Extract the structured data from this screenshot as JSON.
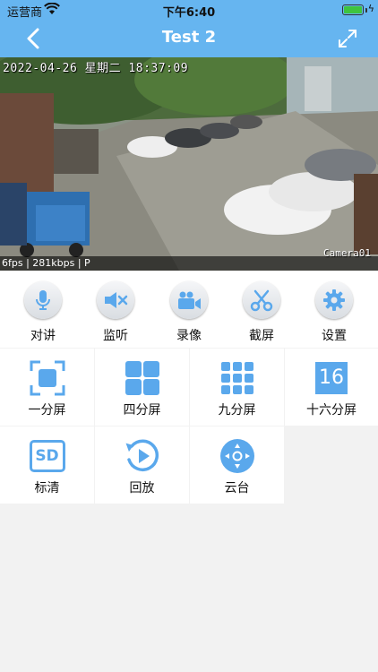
{
  "status_bar": {
    "carrier": "运营商",
    "time": "下午6:40",
    "battery_level": 1.0
  },
  "nav": {
    "title": "Test 2",
    "back_icon": "chevron-left-icon",
    "fullscreen_icon": "expand-icon"
  },
  "video": {
    "timestamp": "2022-04-26 星期二 18:37:09",
    "camera_label": "Camera01",
    "stats": "6fps | 281kbps | P"
  },
  "controls": [
    {
      "label": "对讲",
      "icon": "microphone-icon"
    },
    {
      "label": "监听",
      "icon": "speaker-mute-icon"
    },
    {
      "label": "录像",
      "icon": "video-camera-icon"
    },
    {
      "label": "截屏",
      "icon": "scissors-icon"
    },
    {
      "label": "设置",
      "icon": "gear-icon"
    }
  ],
  "grid": [
    {
      "label": "一分屏",
      "icon": "single-screen-icon"
    },
    {
      "label": "四分屏",
      "icon": "four-screen-icon"
    },
    {
      "label": "九分屏",
      "icon": "nine-screen-icon"
    },
    {
      "label": "十六分屏",
      "icon": "sixteen-screen-icon",
      "icon_text": "16"
    },
    {
      "label": "标清",
      "icon": "sd-quality-icon",
      "icon_text": "SD"
    },
    {
      "label": "回放",
      "icon": "playback-icon"
    },
    {
      "label": "云台",
      "icon": "ptz-icon"
    }
  ],
  "colors": {
    "accent": "#66b5f0",
    "icon_blue": "#5aa8ec",
    "background": "#f2f2f2"
  }
}
